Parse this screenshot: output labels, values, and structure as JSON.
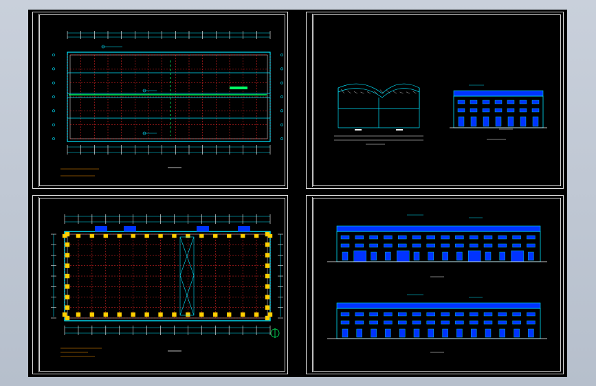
{
  "viewer": {
    "background_color": "#c3cad5",
    "canvas_color": "#000000"
  },
  "colors": {
    "frame": "#ffffff",
    "axis": "#00e5ff",
    "grid_dash": "#ff2a2a",
    "steel": "#00ff66",
    "panel": "#0033ff",
    "column_detail": "#ffd000",
    "text": "#ffffff"
  },
  "sheets": [
    {
      "id": "roof-plan",
      "title": "",
      "scale": ""
    },
    {
      "id": "sections",
      "title": "",
      "scale": ""
    },
    {
      "id": "floor-plan",
      "title": "",
      "scale": ""
    },
    {
      "id": "elevations",
      "title": "",
      "scale": ""
    }
  ],
  "icons": {
    "north_arrow": "north-arrow-icon"
  }
}
